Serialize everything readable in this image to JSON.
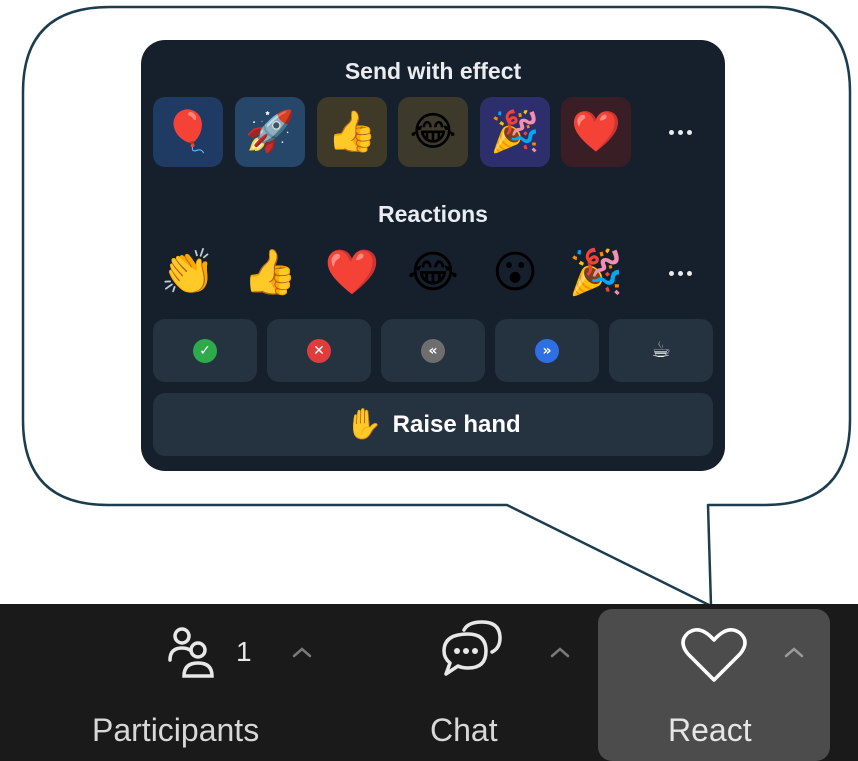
{
  "popup": {
    "effects_title": "Send with effect",
    "effects": [
      {
        "name": "balloon",
        "glyph": "🎈",
        "bg": "#1f3a63"
      },
      {
        "name": "rocket",
        "glyph": "🚀",
        "bg": "#26476a"
      },
      {
        "name": "thumbs-up",
        "glyph": "👍",
        "bg": "#3f3a28"
      },
      {
        "name": "laughing",
        "glyph": "😂",
        "bg": "#3d3a2b"
      },
      {
        "name": "party-popper",
        "glyph": "🎉",
        "bg": "#2d2f6d"
      },
      {
        "name": "heart",
        "glyph": "❤️",
        "bg": "#3a1e26"
      }
    ],
    "reactions_title": "Reactions",
    "reactions": [
      {
        "name": "clap",
        "glyph": "👏"
      },
      {
        "name": "thumbs-up",
        "glyph": "👍"
      },
      {
        "name": "heart",
        "glyph": "❤️"
      },
      {
        "name": "laughing",
        "glyph": "😂"
      },
      {
        "name": "surprised",
        "glyph": "😮"
      },
      {
        "name": "party-popper",
        "glyph": "🎉"
      }
    ],
    "status_buttons": [
      {
        "name": "yes",
        "icon": "check-icon",
        "glyph": "✓",
        "color": "#2eaa4b"
      },
      {
        "name": "no",
        "icon": "close-icon",
        "glyph": "✕",
        "color": "#e03c3c"
      },
      {
        "name": "slow-down",
        "icon": "rewind-icon",
        "glyph": "«",
        "color": "#6e6e6e"
      },
      {
        "name": "speed-up",
        "icon": "fast-forward-icon",
        "glyph": "»",
        "color": "#2f6fe6"
      },
      {
        "name": "coffee",
        "icon": "coffee-icon",
        "glyph": "☕",
        "color": "#253240"
      }
    ],
    "raise_hand_emoji": "✋",
    "raise_hand_label": "Raise hand"
  },
  "toolbar": {
    "participants_label": "Participants",
    "participants_count": "1",
    "chat_label": "Chat",
    "react_label": "React"
  }
}
